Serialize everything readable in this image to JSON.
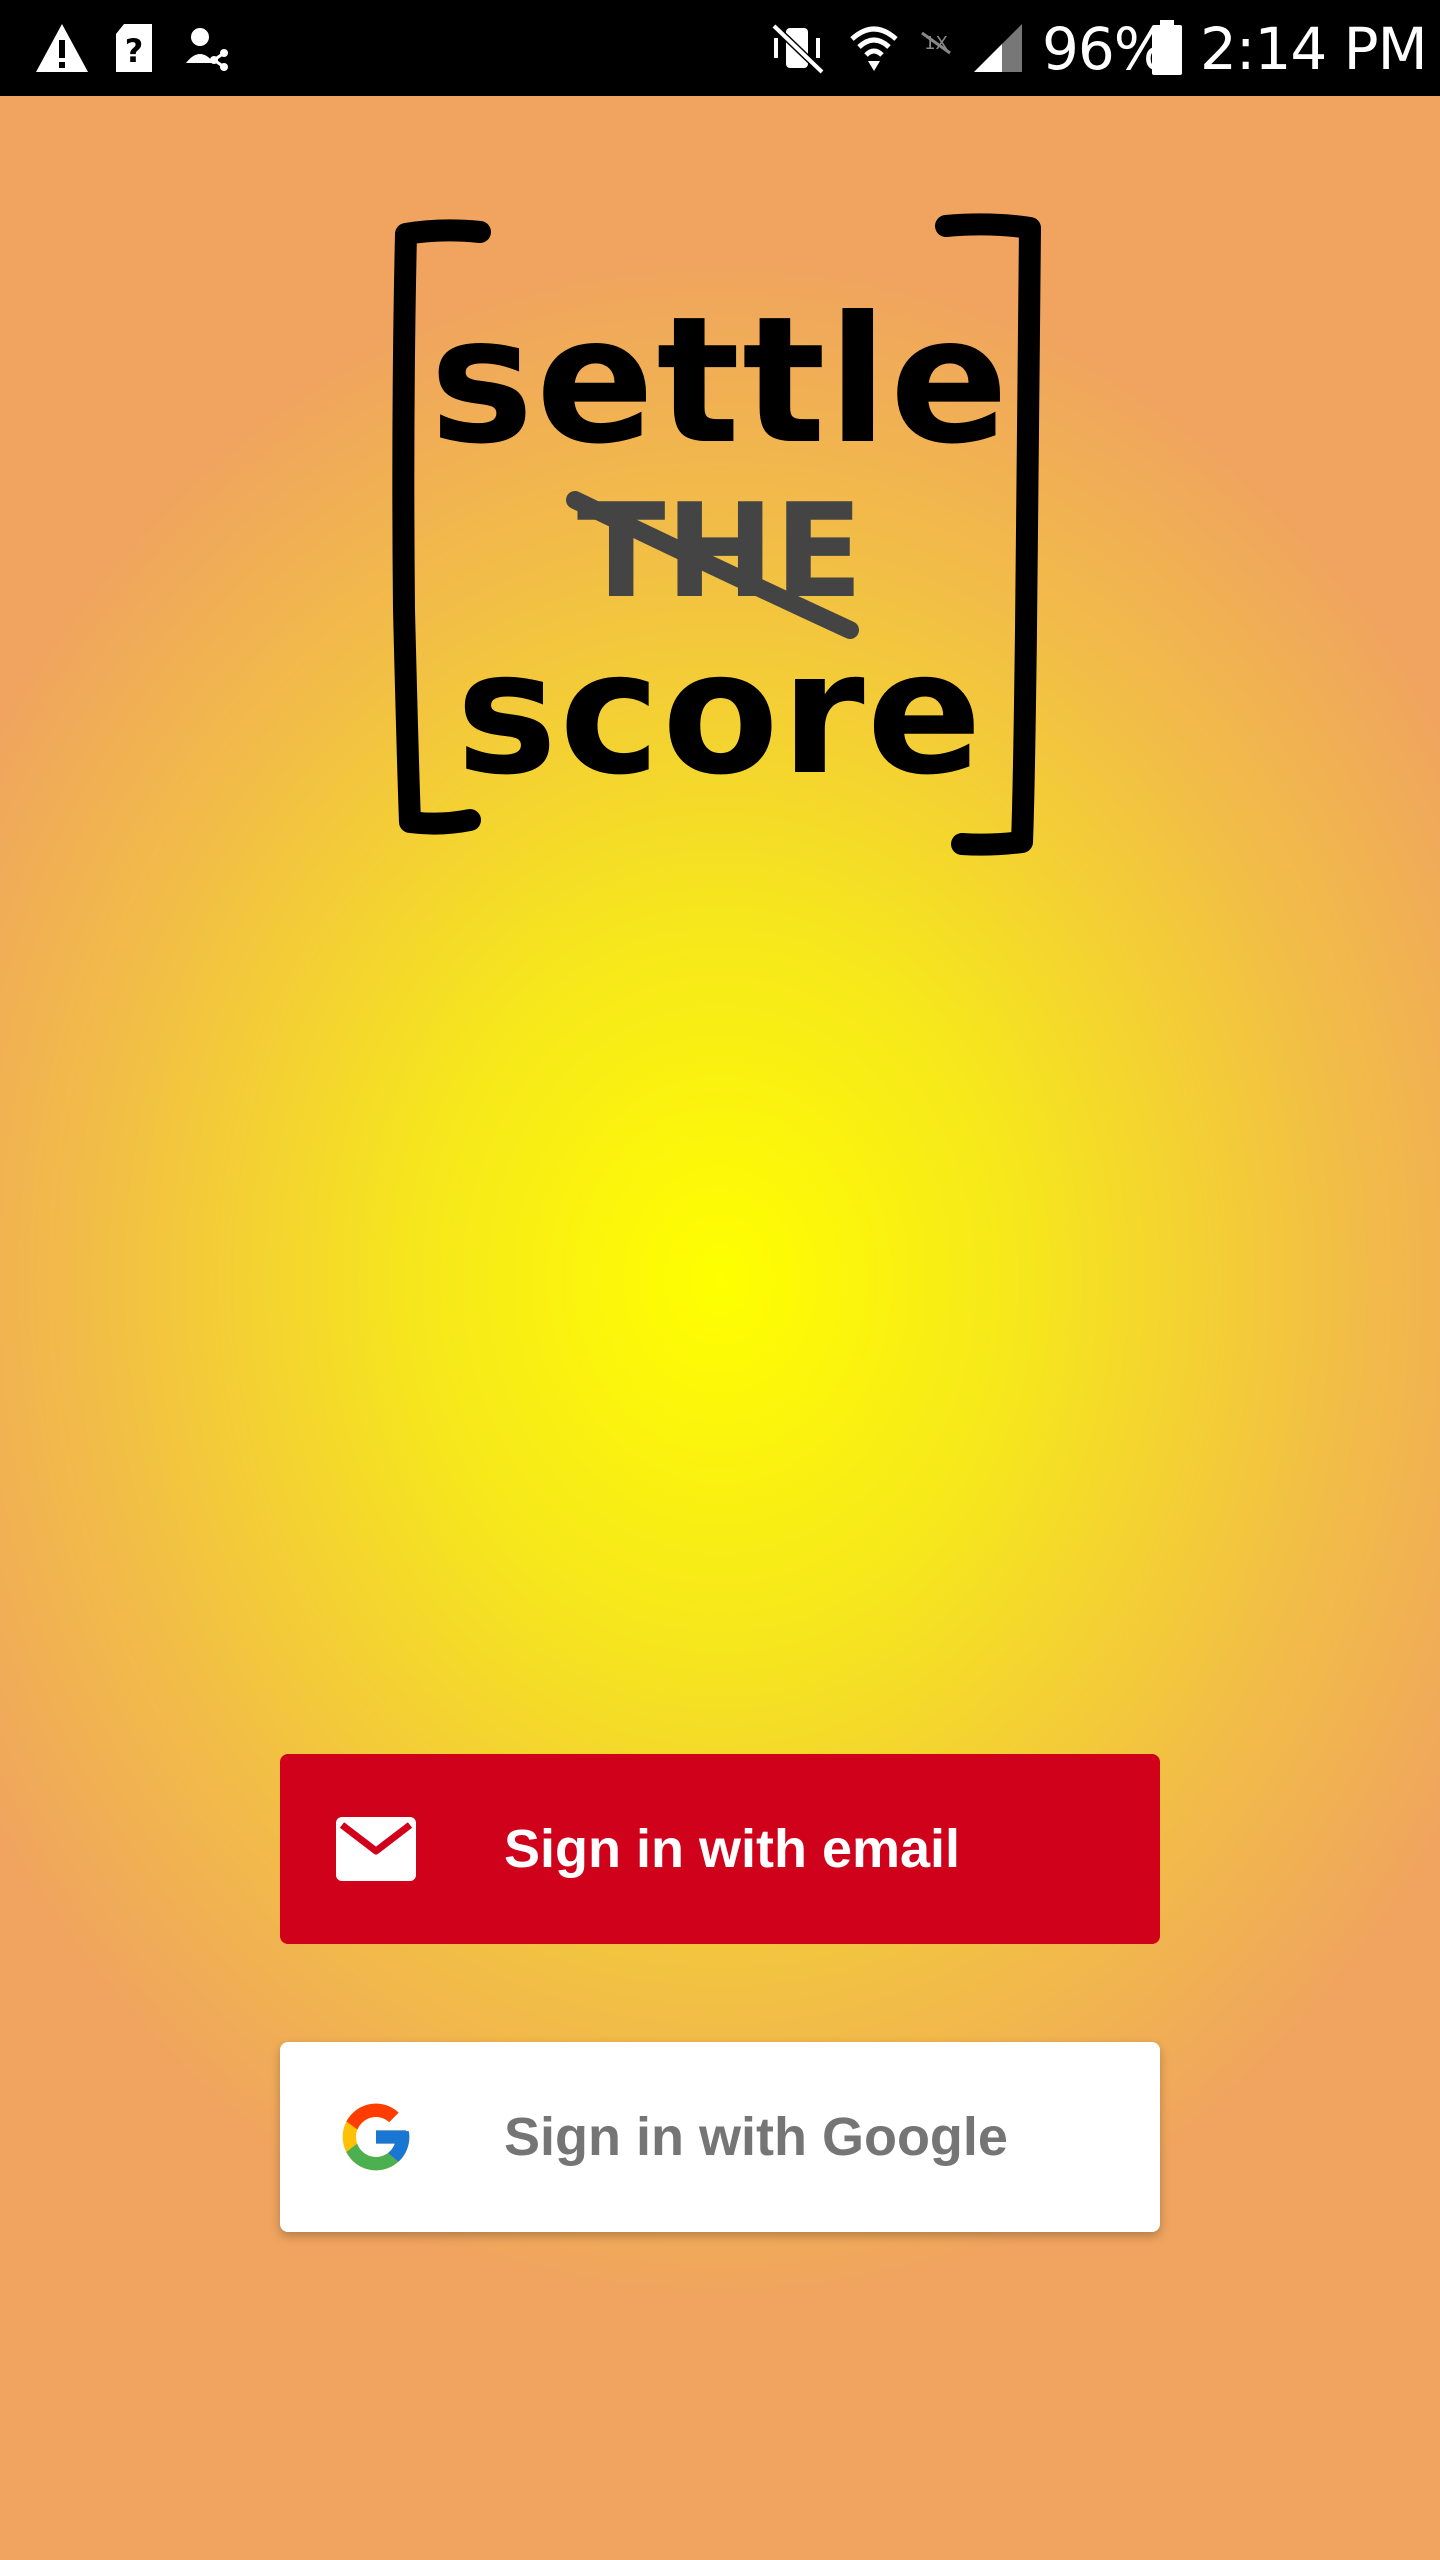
{
  "status_bar": {
    "icons": [
      "warning-icon",
      "sim-unknown-icon",
      "user-share-icon",
      "vibrate-mute-icon",
      "wifi-icon",
      "no-data-icon",
      "signal-icon",
      "battery-icon"
    ],
    "battery": "96%",
    "time": "2:14 PM"
  },
  "logo": {
    "line1": "settle",
    "line2": "THE",
    "line3": "score"
  },
  "buttons": {
    "email_label": "Sign in with email",
    "google_label": "Sign in with Google"
  },
  "colors": {
    "email_button": "#d0021b",
    "google_button": "#ffffff",
    "background_center": "#ffff00",
    "background_edge": "#f0a45f"
  }
}
